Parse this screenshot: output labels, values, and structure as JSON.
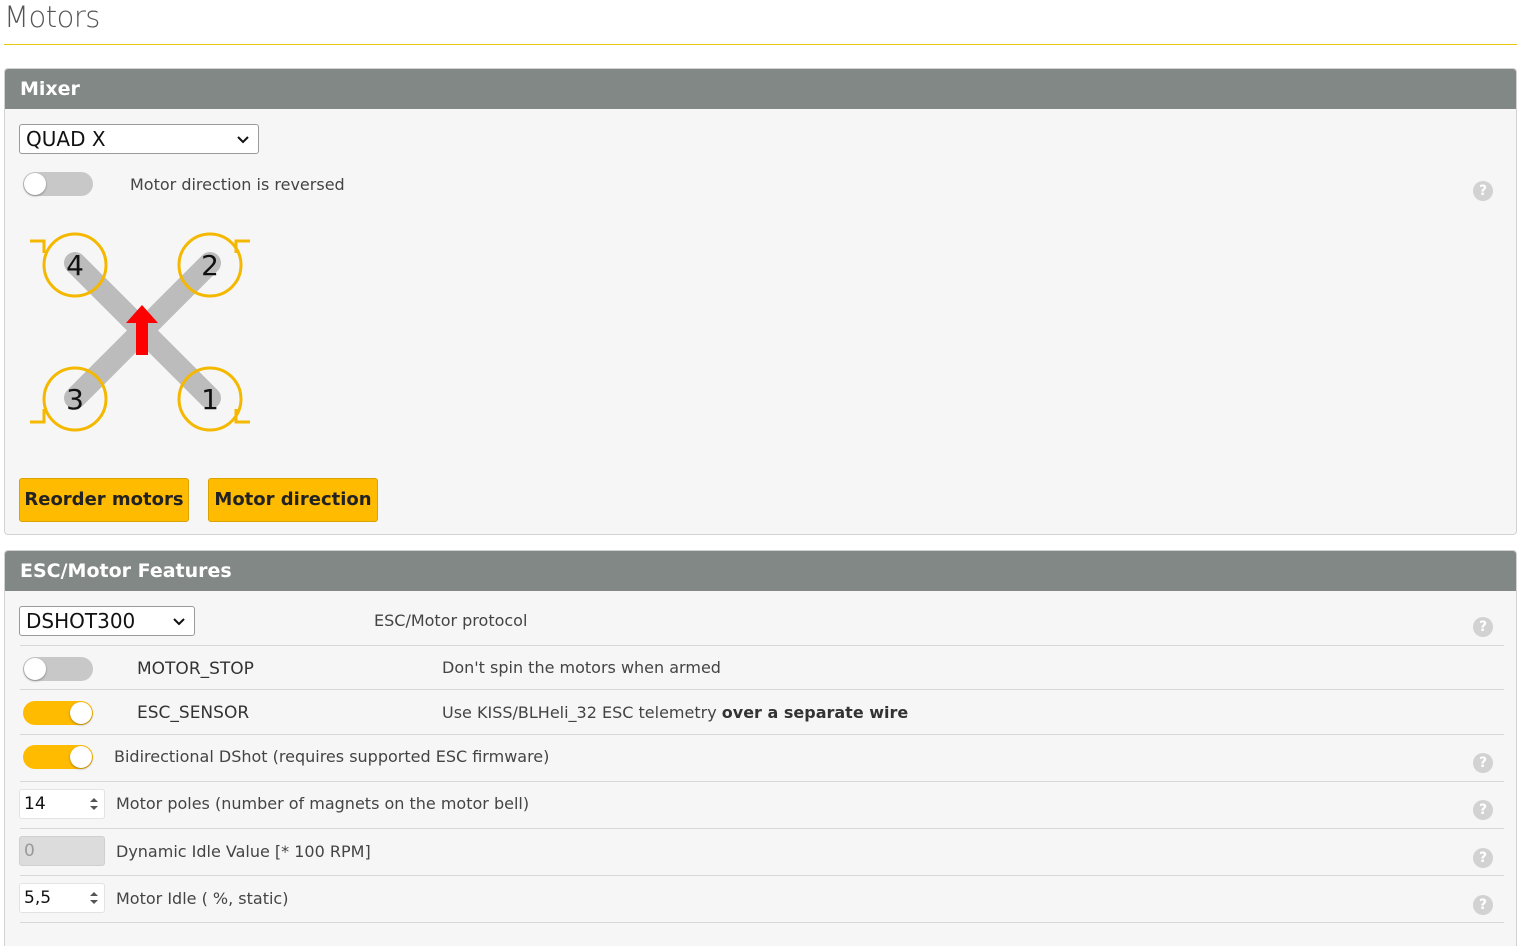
{
  "page": {
    "title": "Motors"
  },
  "mixer": {
    "header": "Mixer",
    "selected_mixer": "QUAD X",
    "reversed_label": "Motor direction is reversed",
    "reversed_on": false,
    "diagram": {
      "motors": [
        "4",
        "2",
        "3",
        "1"
      ]
    },
    "reorder_button": "Reorder motors",
    "direction_button": "Motor direction"
  },
  "esc": {
    "header": "ESC/Motor Features",
    "protocol_value": "DSHOT300",
    "protocol_label": "ESC/Motor protocol",
    "motor_stop": {
      "name": "MOTOR_STOP",
      "desc": "Don't spin the motors when armed",
      "on": false
    },
    "esc_sensor": {
      "name": "ESC_SENSOR",
      "desc_prefix": "Use KISS/BLHeli_32 ESC telemetry ",
      "desc_bold": "over a separate wire",
      "on": true
    },
    "bidir": {
      "label": "Bidirectional DShot (requires supported ESC firmware)",
      "on": true
    },
    "poles": {
      "value": "14",
      "label": "Motor poles (number of magnets on the motor bell)"
    },
    "dyn_idle": {
      "value": "0",
      "label": "Dynamic Idle Value [* 100 RPM]"
    },
    "motor_idle": {
      "value": "5,5",
      "label": "Motor Idle ( %, static)"
    }
  },
  "help_icon": "?",
  "colors": {
    "accent": "#ffbb00",
    "header_bg": "#828885",
    "arrow": "#ff0000"
  }
}
